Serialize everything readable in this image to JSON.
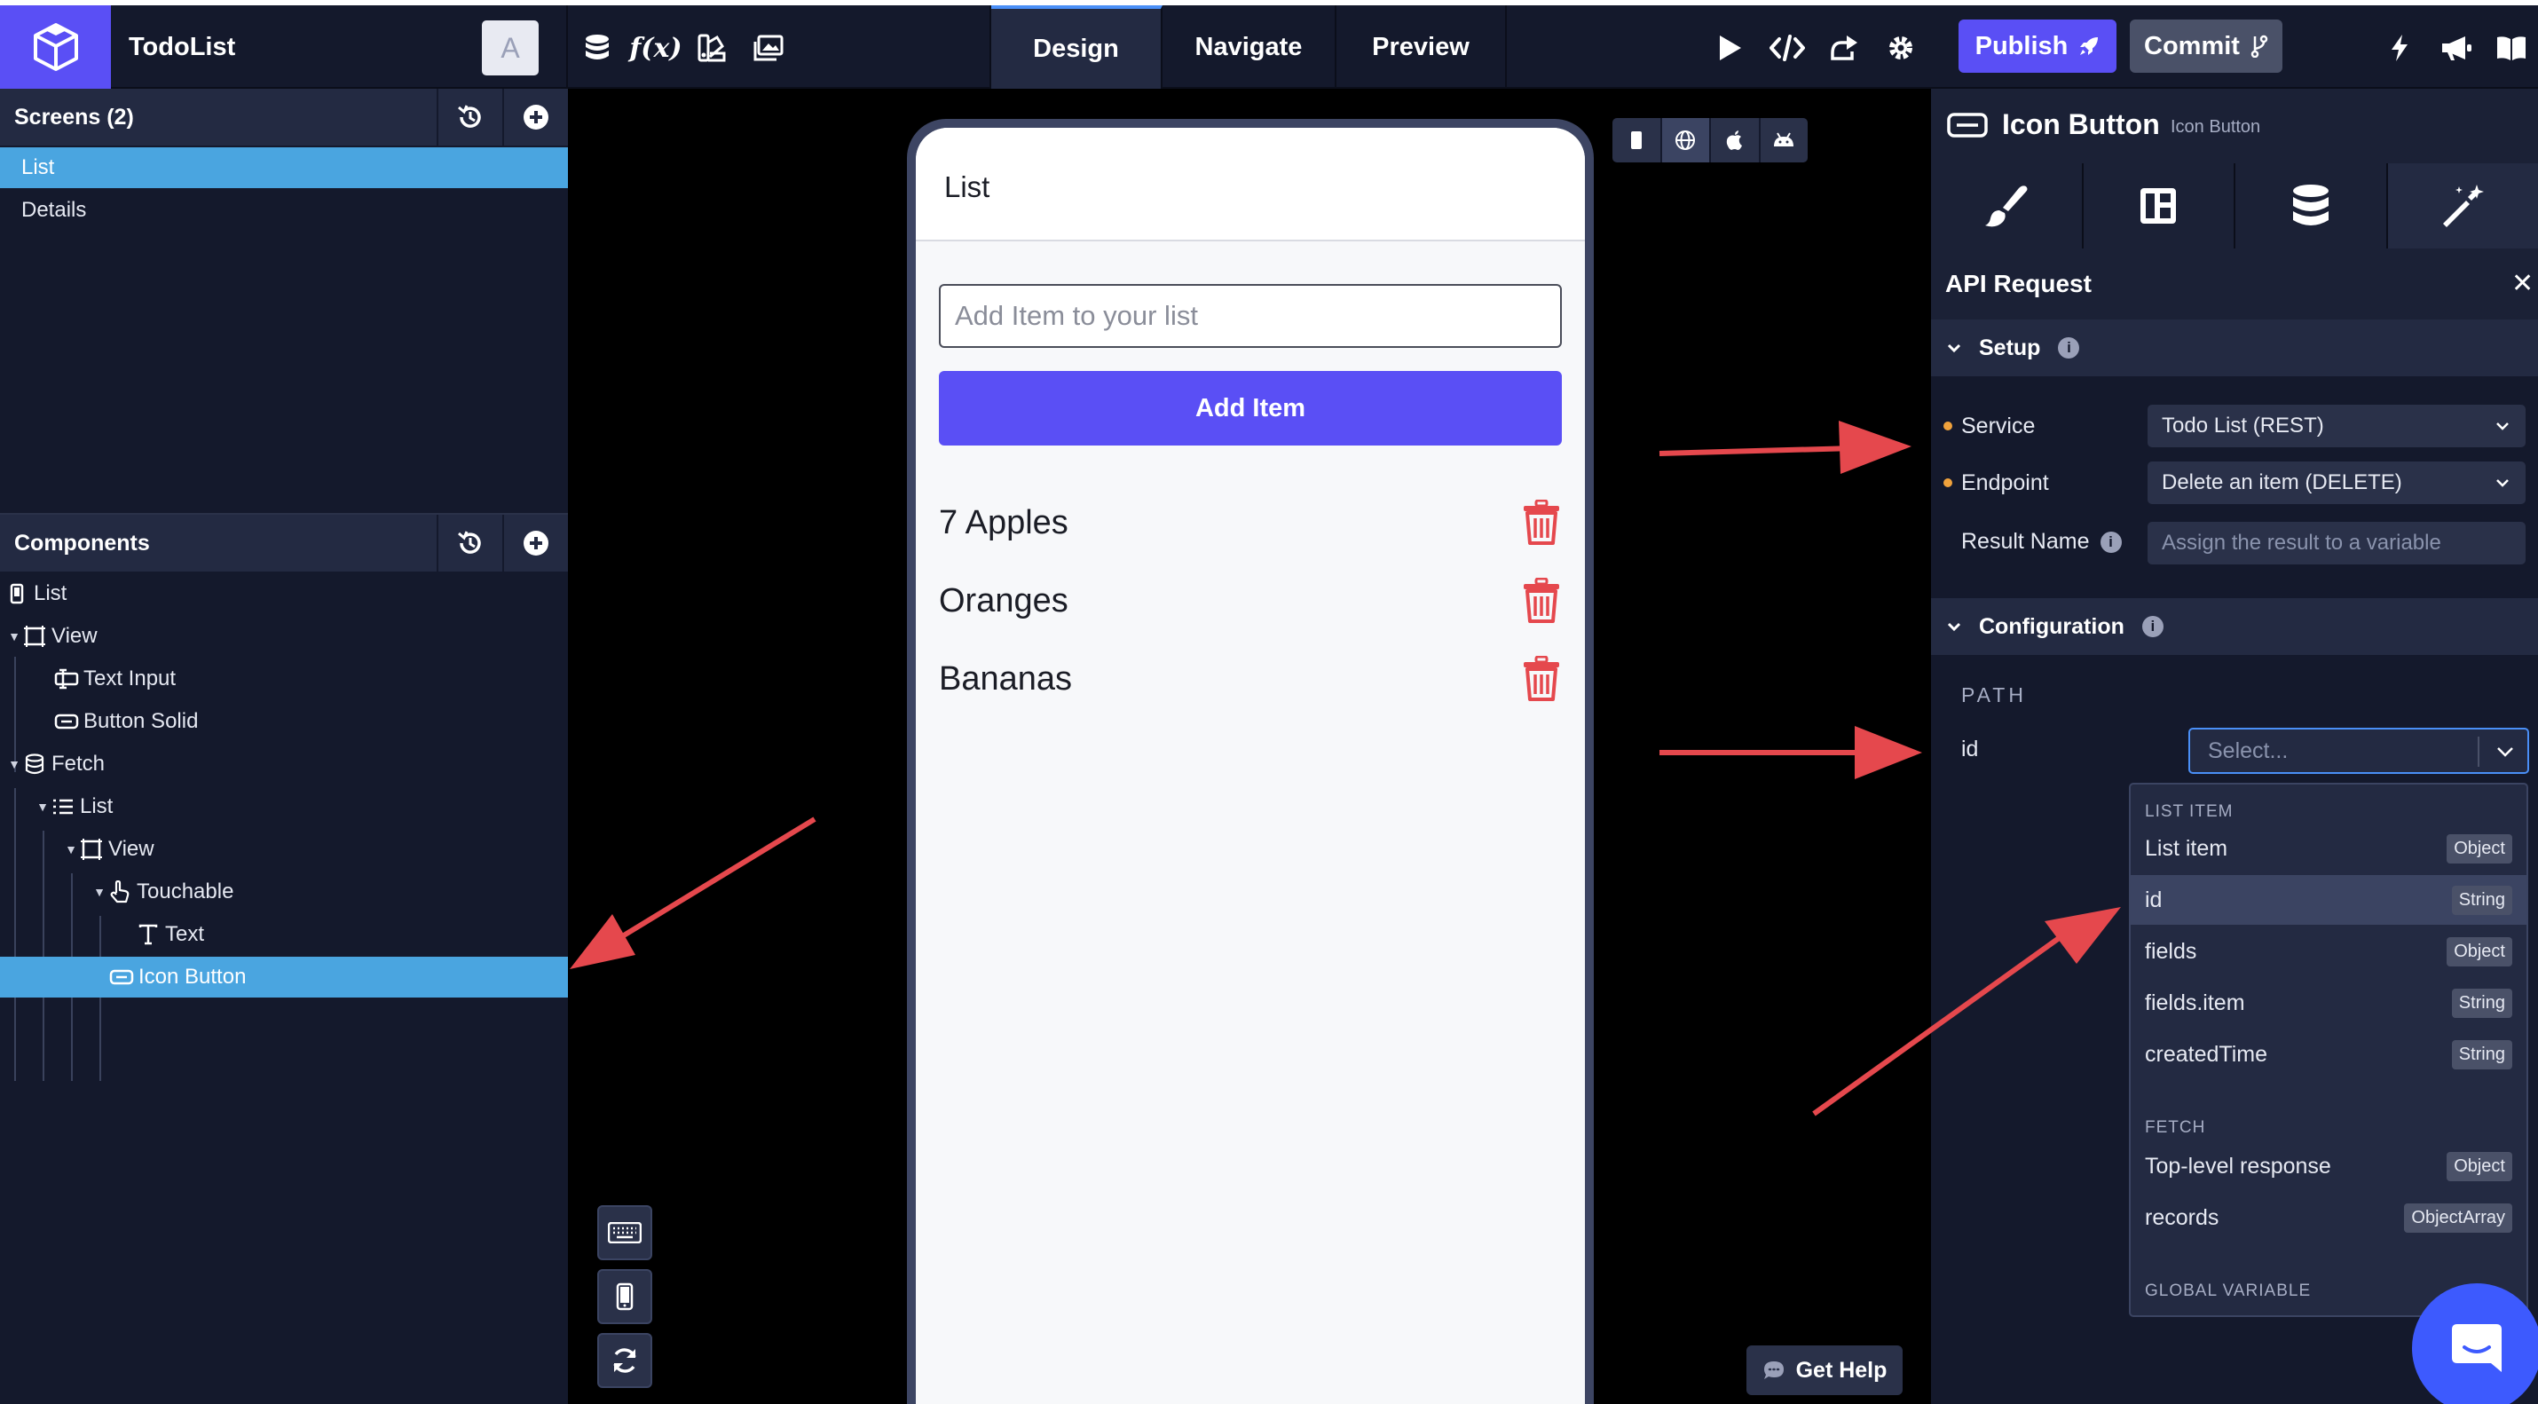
{
  "app": {
    "title": "TodoList",
    "avatar_letter": "A"
  },
  "toolbar": {
    "tabs": [
      {
        "label": "Design",
        "active": true
      },
      {
        "label": "Navigate",
        "active": false
      },
      {
        "label": "Preview",
        "active": false
      }
    ],
    "functions_label": "f(x)",
    "publish_label": "Publish",
    "commit_label": "Commit"
  },
  "screens": {
    "header": "Screens (2)",
    "items": [
      {
        "label": "List",
        "selected": true
      },
      {
        "label": "Details",
        "selected": false
      }
    ]
  },
  "components": {
    "header": "Components",
    "tree": [
      {
        "label": "List",
        "depth": 0,
        "icon": "phone-icon",
        "expanded": null,
        "selected": false
      },
      {
        "label": "View",
        "depth": 0,
        "icon": "view-frame-icon",
        "expanded": true,
        "selected": false
      },
      {
        "label": "Text Input",
        "depth": 1,
        "icon": "text-input-icon",
        "expanded": null,
        "selected": false
      },
      {
        "label": "Button Solid",
        "depth": 1,
        "icon": "button-icon",
        "expanded": null,
        "selected": false
      },
      {
        "label": "Fetch",
        "depth": 0,
        "icon": "database-icon",
        "expanded": true,
        "selected": false
      },
      {
        "label": "List",
        "depth": 1,
        "icon": "list-icon",
        "expanded": true,
        "selected": false
      },
      {
        "label": "View",
        "depth": 2,
        "icon": "view-frame-icon",
        "expanded": true,
        "selected": false
      },
      {
        "label": "Touchable",
        "depth": 3,
        "icon": "hand-pointer-icon",
        "expanded": true,
        "selected": false
      },
      {
        "label": "Text",
        "depth": 4,
        "icon": "text-t-icon",
        "expanded": null,
        "selected": false
      },
      {
        "label": "Icon Button",
        "depth": 4,
        "icon": "button-icon",
        "expanded": null,
        "selected": true
      }
    ]
  },
  "preview": {
    "header_title": "List",
    "input_placeholder": "Add Item to your list",
    "add_button": "Add Item",
    "items": [
      "7 Apples",
      "Oranges",
      "Bananas"
    ],
    "help_label": "Get Help",
    "accent_color": "#5a4ff5",
    "delete_color": "#e5484d"
  },
  "inspector": {
    "component_title": "Icon Button",
    "component_type": "Icon Button",
    "panel_title": "API Request",
    "setup": {
      "title": "Setup",
      "service_label": "Service",
      "service_value": "Todo List (REST)",
      "endpoint_label": "Endpoint",
      "endpoint_value": "Delete an item (DELETE)",
      "result_label": "Result Name",
      "result_placeholder": "Assign the result to a variable"
    },
    "configuration": {
      "title": "Configuration",
      "path_label": "PATH",
      "param_label": "id",
      "select_placeholder": "Select..."
    },
    "dropdown": {
      "groups": [
        {
          "title": "LIST ITEM",
          "items": [
            {
              "label": "List item",
              "type": "Object",
              "highlighted": false
            },
            {
              "label": "id",
              "type": "String",
              "highlighted": true
            },
            {
              "label": "fields",
              "type": "Object",
              "highlighted": false
            },
            {
              "label": "fields.item",
              "type": "String",
              "highlighted": false
            },
            {
              "label": "createdTime",
              "type": "String",
              "highlighted": false
            }
          ]
        },
        {
          "title": "FETCH",
          "items": [
            {
              "label": "Top-level response",
              "type": "Object",
              "highlighted": false
            },
            {
              "label": "records",
              "type": "ObjectArray",
              "highlighted": false
            }
          ]
        },
        {
          "title": "GLOBAL VARIABLE",
          "items": []
        }
      ]
    }
  },
  "colors": {
    "brand": "#5a4ff5",
    "selection": "#4aa5e0",
    "annotation_arrow": "#e5484d",
    "required_dot": "#f0a23c"
  }
}
